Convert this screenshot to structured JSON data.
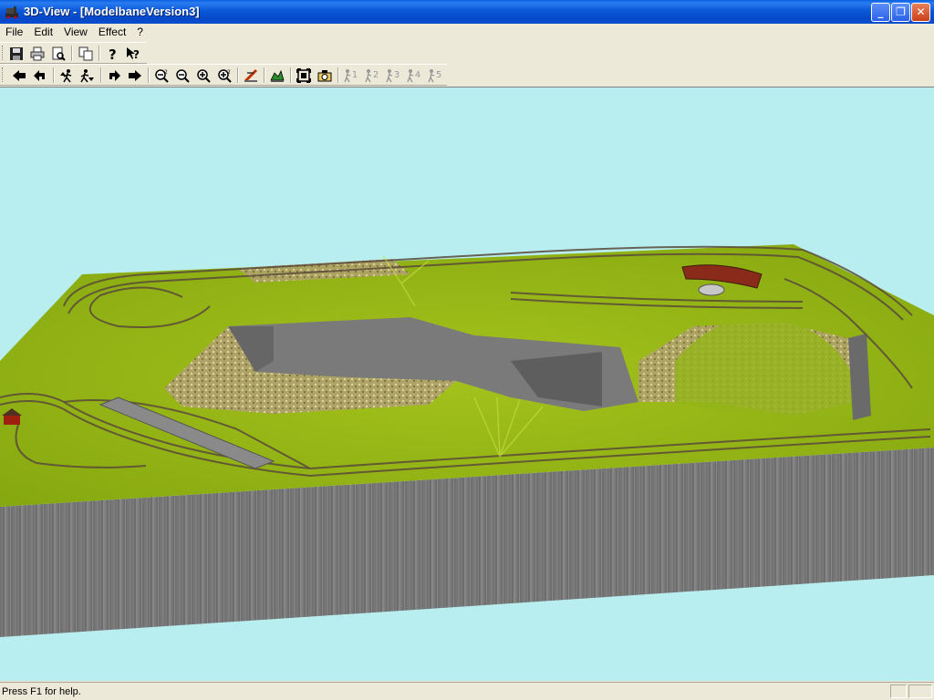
{
  "window": {
    "title": "3D-View - [ModelbaneVersion3]",
    "controls": {
      "minimize": "_",
      "restore": "❐",
      "close": "✕"
    },
    "colors": {
      "titlebar": "#0a58d8",
      "chrome": "#ece9d8",
      "sky": "#b8eef0"
    }
  },
  "menu": {
    "items": [
      {
        "label": "File"
      },
      {
        "label": "Edit"
      },
      {
        "label": "View"
      },
      {
        "label": "Effect"
      },
      {
        "label": "?"
      }
    ]
  },
  "toolbar_main": {
    "buttons": [
      {
        "icon": "save-icon"
      },
      {
        "icon": "print-icon"
      },
      {
        "icon": "print-preview-icon"
      },
      {
        "icon": "copy-icon"
      },
      {
        "icon": "help-icon"
      },
      {
        "icon": "context-help-icon"
      }
    ]
  },
  "toolbar_view": {
    "buttons": [
      {
        "icon": "arrow-left-icon"
      },
      {
        "icon": "turn-left-icon"
      },
      {
        "icon": "walker-up-icon"
      },
      {
        "icon": "walker-down-icon"
      },
      {
        "icon": "turn-right-icon"
      },
      {
        "icon": "arrow-right-icon"
      },
      {
        "icon": "zoom-out-all-icon"
      },
      {
        "icon": "zoom-out-icon"
      },
      {
        "icon": "zoom-in-icon"
      },
      {
        "icon": "zoom-in-all-icon"
      },
      {
        "icon": "track-edit-icon"
      },
      {
        "icon": "terrain-icon"
      },
      {
        "icon": "fit-view-icon"
      },
      {
        "icon": "camera-icon"
      }
    ],
    "camera_presets": [
      {
        "label": "1",
        "enabled": false
      },
      {
        "label": "2",
        "enabled": false
      },
      {
        "label": "3",
        "enabled": false
      },
      {
        "label": "4",
        "enabled": false
      },
      {
        "label": "5",
        "enabled": false
      }
    ]
  },
  "status": {
    "text": "Press F1 for help."
  }
}
